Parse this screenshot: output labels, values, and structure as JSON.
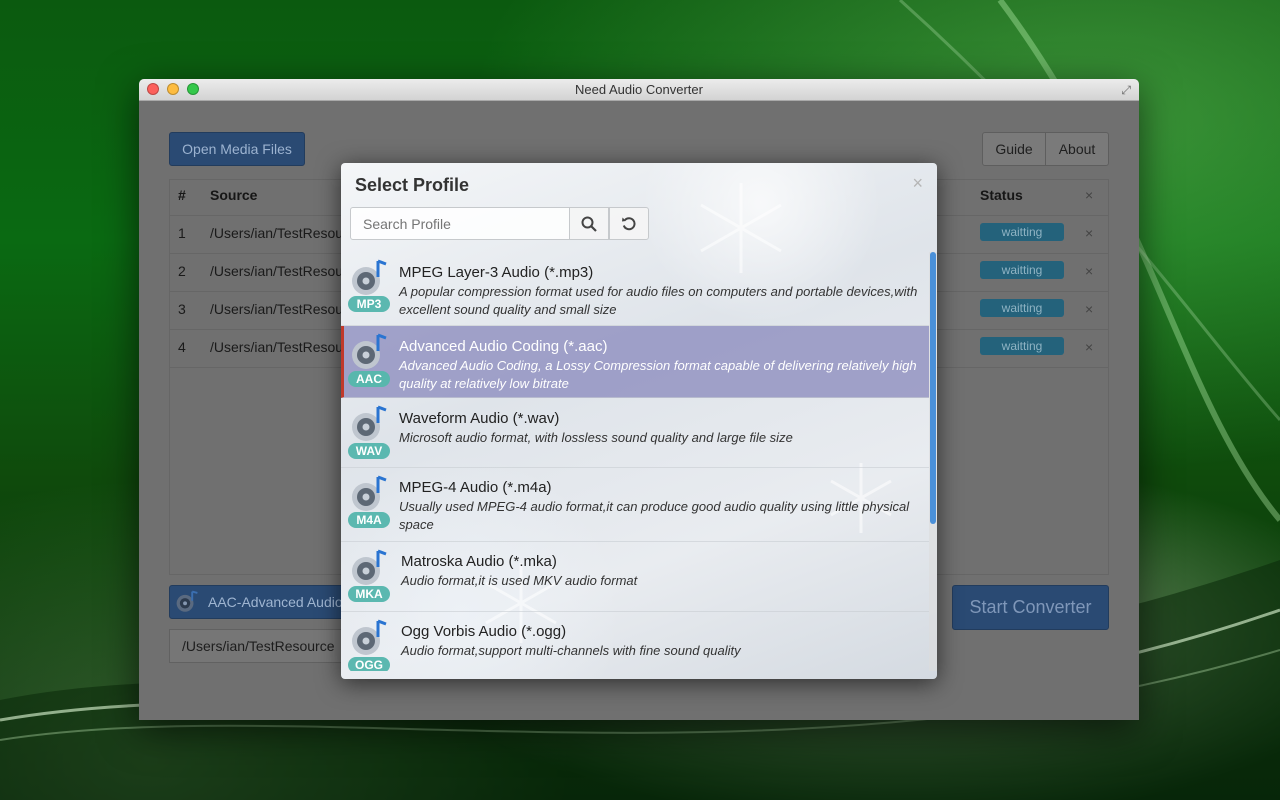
{
  "window": {
    "title": "Need Audio Converter",
    "fullscreen_glyph": "⤢"
  },
  "toolbar": {
    "open_media": "Open Media Files",
    "guide": "Guide",
    "about": "About"
  },
  "table": {
    "headers": {
      "num": "#",
      "source": "Source",
      "status": "Status",
      "remove": "×"
    },
    "rows": [
      {
        "num": "1",
        "source": "/Users/ian/TestResou",
        "status": "waitting",
        "remove": "×"
      },
      {
        "num": "2",
        "source": "/Users/ian/TestResou",
        "status": "waitting",
        "remove": "×"
      },
      {
        "num": "3",
        "source": "/Users/ian/TestResou",
        "status": "waitting",
        "remove": "×"
      },
      {
        "num": "4",
        "source": "/Users/ian/TestResou",
        "status": "waitting",
        "remove": "×"
      }
    ]
  },
  "output": {
    "format": "AAC-Advanced Audio",
    "path": "/Users/ian/TestResource",
    "start": "Start Converter"
  },
  "modal": {
    "title": "Select Profile",
    "close": "×",
    "search_placeholder": "Search Profile",
    "profiles": [
      {
        "badge": "MP3",
        "name": "MPEG Layer-3 Audio (*.mp3)",
        "desc": "A popular compression format used for audio files on computers and portable devices,with excellent sound quality and small size",
        "selected": false
      },
      {
        "badge": "AAC",
        "name": "Advanced Audio Coding (*.aac)",
        "desc": "Advanced Audio Coding, a Lossy Compression format capable of delivering relatively high quality at relatively low bitrate",
        "selected": true
      },
      {
        "badge": "WAV",
        "name": "Waveform Audio (*.wav)",
        "desc": "Microsoft audio format, with lossless sound quality and large file size",
        "selected": false
      },
      {
        "badge": "M4A",
        "name": "MPEG-4 Audio (*.m4a)",
        "desc": "Usually used MPEG-4 audio format,it can produce good audio quality using little physical space",
        "selected": false
      },
      {
        "badge": "MKA",
        "name": "Matroska Audio (*.mka)",
        "desc": "Audio format,it is used MKV audio format",
        "selected": false
      },
      {
        "badge": "OGG",
        "name": "Ogg Vorbis Audio (*.ogg)",
        "desc": "Audio format,support multi-channels with fine sound quality",
        "selected": false
      }
    ]
  },
  "colors": {
    "accent": "#4a90d9",
    "badge": "#5bb8b0",
    "selected_row": "#8c8cbe",
    "selected_marker": "#c0392b"
  },
  "icons": {
    "search": "search-icon",
    "reset": "refresh-icon",
    "profile": "speaker-note-icon"
  }
}
